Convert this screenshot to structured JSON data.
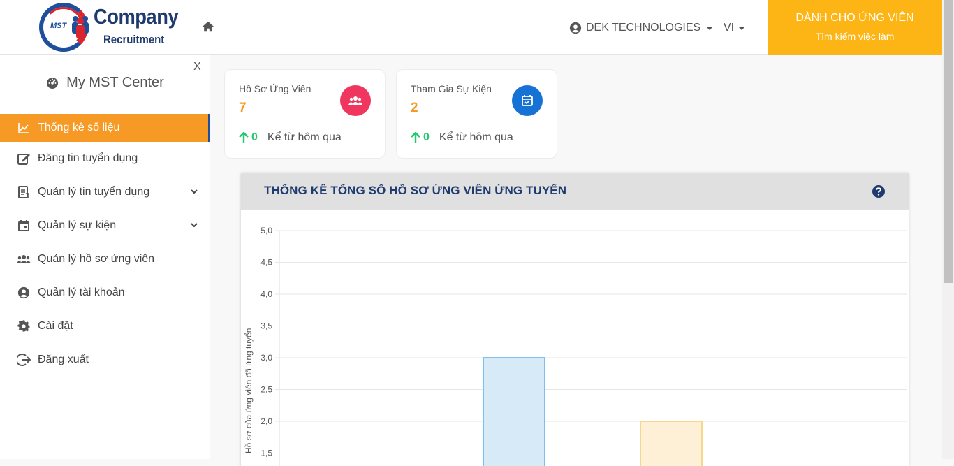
{
  "header": {
    "logo_text_1": "Company",
    "logo_text_2": "Recruitment",
    "logo_mst": "MST",
    "company_name": "DEK TECHNOLOGIES",
    "language": "VI",
    "candidate_title": "DÀNH CHO ỨNG VIÊN",
    "candidate_subtitle": "Tìm kiếm việc làm"
  },
  "sidebar": {
    "close": "X",
    "title": "My MST Center",
    "items": [
      {
        "label": "Thống kê số liệu",
        "icon": "line-chart-icon"
      },
      {
        "label": "Đăng tin tuyển dụng",
        "icon": "edit-icon"
      },
      {
        "label": "Quản lý tin tuyển dụng",
        "icon": "document-list-icon"
      },
      {
        "label": "Quản lý sự kiện",
        "icon": "calendar-icon"
      },
      {
        "label": "Quản lý hồ sơ ứng viên",
        "icon": "users-icon"
      },
      {
        "label": "Quản lý tài khoản",
        "icon": "user-circle-icon"
      },
      {
        "label": "Cài đặt",
        "icon": "gear-icon"
      },
      {
        "label": "Đăng xuất",
        "icon": "logout-icon"
      }
    ]
  },
  "cards": [
    {
      "label": "Hồ Sơ Ứng Viên",
      "value": "7",
      "delta": "0",
      "since": "Kể từ hôm qua",
      "color": "#f0365e"
    },
    {
      "label": "Tham Gia Sự Kiện",
      "value": "2",
      "delta": "0",
      "since": "Kể từ hôm qua",
      "color": "#1672d4"
    }
  ],
  "panel": {
    "title": "THỐNG KÊ TỔNG SỐ HỒ SƠ ỨNG VIÊN ỨNG TUYỂN"
  },
  "chart_data": {
    "type": "bar",
    "ylabel": "Hồ sơ của ứng viên đã ứng tuyển",
    "ylim": [
      1.5,
      5.0
    ],
    "yticks": [
      "5,0",
      "4,5",
      "4,0",
      "3,5",
      "3,0",
      "2,5",
      "2,0",
      "1,5"
    ],
    "series": [
      {
        "value": 3.0,
        "fill": "#d6eaf8",
        "stroke": "#7fbfec"
      },
      {
        "value": 2.0,
        "fill": "#fdf0d6",
        "stroke": "#f7d88a"
      }
    ],
    "grid": true
  }
}
